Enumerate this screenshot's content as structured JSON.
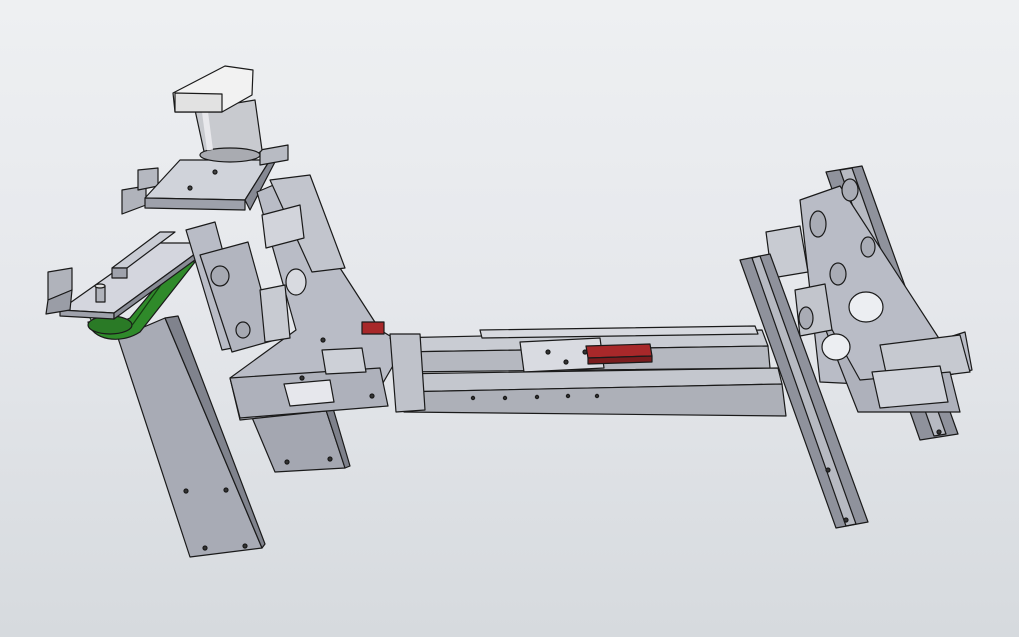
{
  "viewport": {
    "background_top": "#eef0f2",
    "background_bottom": "#d6dade"
  },
  "model": {
    "part_colors": {
      "steel": "#b9bcc6",
      "steel_light": "#d4d6de",
      "steel_dark": "#8a8d98",
      "motor_body": "#c8cacf",
      "motor_cap": "#f2f2f2",
      "belt_green": "#2f8a2a",
      "limit_block_red": "#a8282a",
      "edge": "#1a1a1a"
    },
    "components": [
      {
        "name": "servo-motor",
        "color_key": "motor_body"
      },
      {
        "name": "motor-mount-plate",
        "color_key": "steel_light"
      },
      {
        "name": "tool-head-plate",
        "color_key": "steel_light"
      },
      {
        "name": "timing-belt-pulley",
        "color_key": "belt_green"
      },
      {
        "name": "left-vertical-arm",
        "color_key": "steel"
      },
      {
        "name": "left-support-column",
        "color_key": "steel"
      },
      {
        "name": "left-bracket-plate",
        "color_key": "steel"
      },
      {
        "name": "linear-rail-upper",
        "color_key": "steel_light"
      },
      {
        "name": "linear-rail-lower",
        "color_key": "steel"
      },
      {
        "name": "sliding-carriage",
        "color_key": "steel_light"
      },
      {
        "name": "limit-block",
        "color_key": "limit_block_red"
      },
      {
        "name": "right-bracket-plate",
        "color_key": "steel"
      },
      {
        "name": "right-guide-rail-front",
        "color_key": "steel_dark"
      },
      {
        "name": "right-guide-rail-back",
        "color_key": "steel_dark"
      },
      {
        "name": "right-base-foot",
        "color_key": "steel_light"
      }
    ]
  }
}
